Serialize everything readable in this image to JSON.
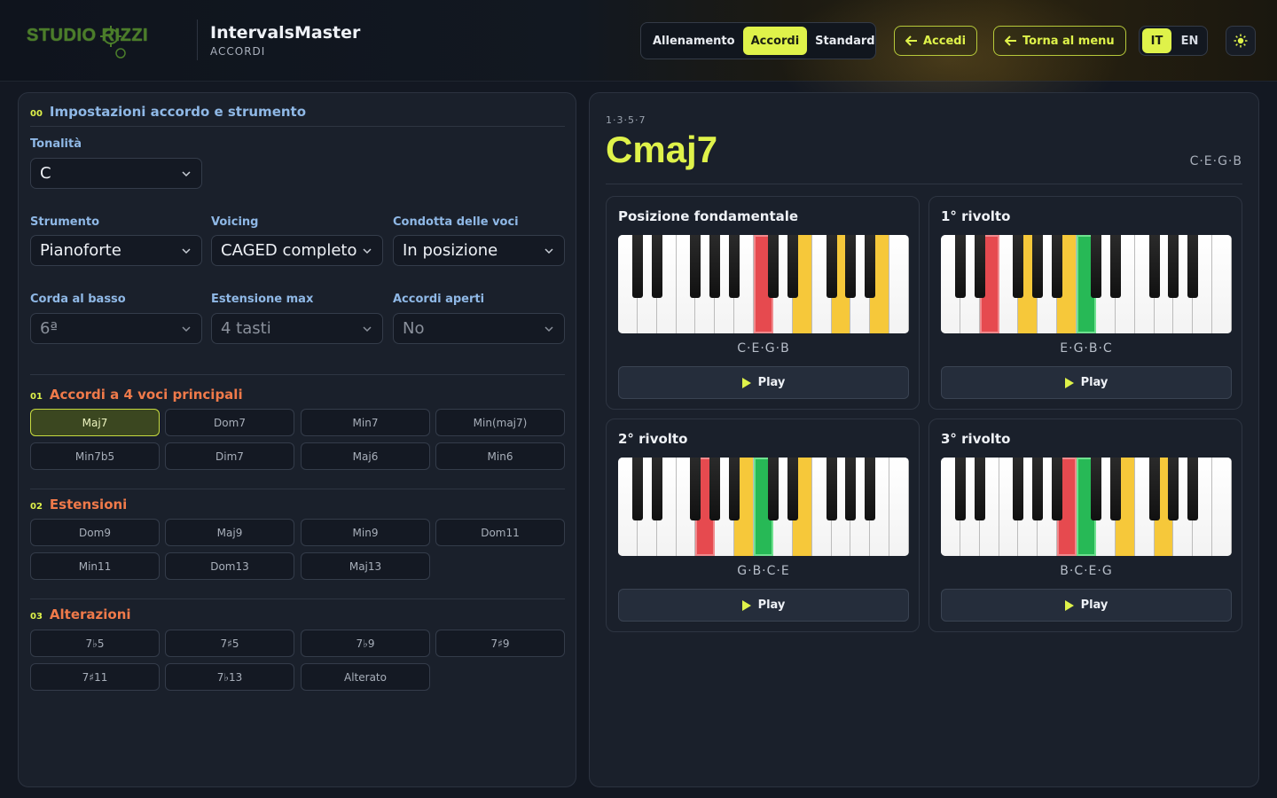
{
  "header": {
    "logo_text": "STUDIO RIZZI",
    "app_title": "IntervalsMaster",
    "app_subtitle": "ACCORDI",
    "modes": [
      "Allenamento",
      "Accordi",
      "Standard"
    ],
    "active_mode": "Accordi",
    "login_label": "Accedi",
    "back_label": "Torna al menu",
    "languages": [
      "IT",
      "EN"
    ],
    "active_language": "IT"
  },
  "settings": {
    "section_num": "00",
    "section_title": "Impostazioni accordo e strumento",
    "key_label": "Tonalità",
    "key_value": "C",
    "instrument_label": "Strumento",
    "instrument_value": "Pianoforte",
    "voicing_label": "Voicing",
    "voicing_value": "CAGED completo",
    "voice_leading_label": "Condotta delle voci",
    "voice_leading_value": "In posizione",
    "bass_string_label": "Corda al basso",
    "bass_string_value": "6ª",
    "max_span_label": "Estensione max",
    "max_span_value": "4 tasti",
    "open_chords_label": "Accordi aperti",
    "open_chords_value": "No"
  },
  "groups": [
    {
      "num": "01",
      "title": "Accordi a 4 voci principali",
      "items": [
        "Maj7",
        "Dom7",
        "Min7",
        "Min(maj7)",
        "Min7b5",
        "Dim7",
        "Maj6",
        "Min6"
      ],
      "active": "Maj7"
    },
    {
      "num": "02",
      "title": "Estensioni",
      "items": [
        "Dom9",
        "Maj9",
        "Min9",
        "Dom11",
        "Min11",
        "Dom13",
        "Maj13"
      ]
    },
    {
      "num": "03",
      "title": "Alterazioni",
      "items": [
        "7♭5",
        "7♯5",
        "7♭9",
        "7♯9",
        "7♯11",
        "7♭13",
        "Alterato"
      ]
    }
  ],
  "chord": {
    "formula": "1·3·5·7",
    "name": "Cmaj7",
    "notes": "C·E·G·B"
  },
  "inversions": [
    {
      "title": "Posizione fondamentale",
      "notes": "C·E·G·B",
      "play_label": "Play",
      "keys": {
        "red": [
          7
        ],
        "yellow": [
          9,
          11,
          13
        ],
        "green": []
      }
    },
    {
      "title": "1° rivolto",
      "notes": "E·G·B·C",
      "play_label": "Play",
      "keys": {
        "red": [
          2
        ],
        "yellow": [
          4,
          6
        ],
        "green": [
          7
        ]
      }
    },
    {
      "title": "2° rivolto",
      "notes": "G·B·C·E",
      "play_label": "Play",
      "keys": {
        "red": [
          4
        ],
        "yellow": [
          6,
          9
        ],
        "green": [
          7
        ]
      }
    },
    {
      "title": "3° rivolto",
      "notes": "B·C·E·G",
      "play_label": "Play",
      "keys": {
        "red": [
          6
        ],
        "yellow": [
          9,
          11
        ],
        "green": [
          7
        ]
      }
    }
  ],
  "colors": {
    "accent": "#dff24a",
    "section_blue": "#8fb8e6",
    "section_orange": "#f07a4a",
    "root_red": "#e64a4f",
    "chord_yellow": "#f6c83a",
    "inversion_green": "#27b956"
  }
}
